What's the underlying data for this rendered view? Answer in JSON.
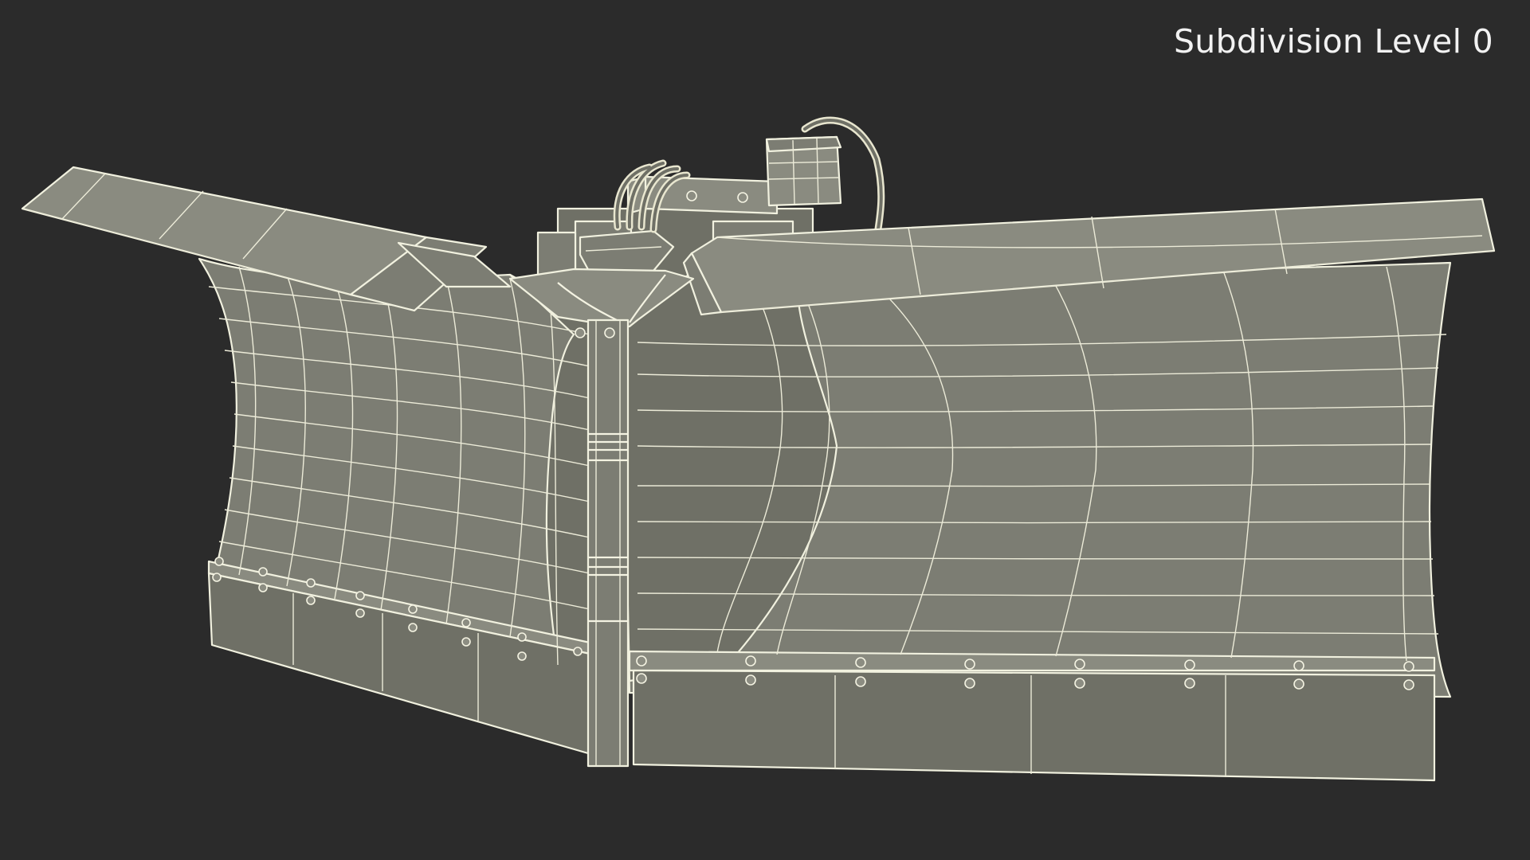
{
  "viewport": {
    "overlay_label": "Subdivision Level 0"
  },
  "colors": {
    "background": "#2b2b2b",
    "surface": "#7c7d73",
    "wireframe": "#f1f1df",
    "label": "#f2f2f2"
  }
}
